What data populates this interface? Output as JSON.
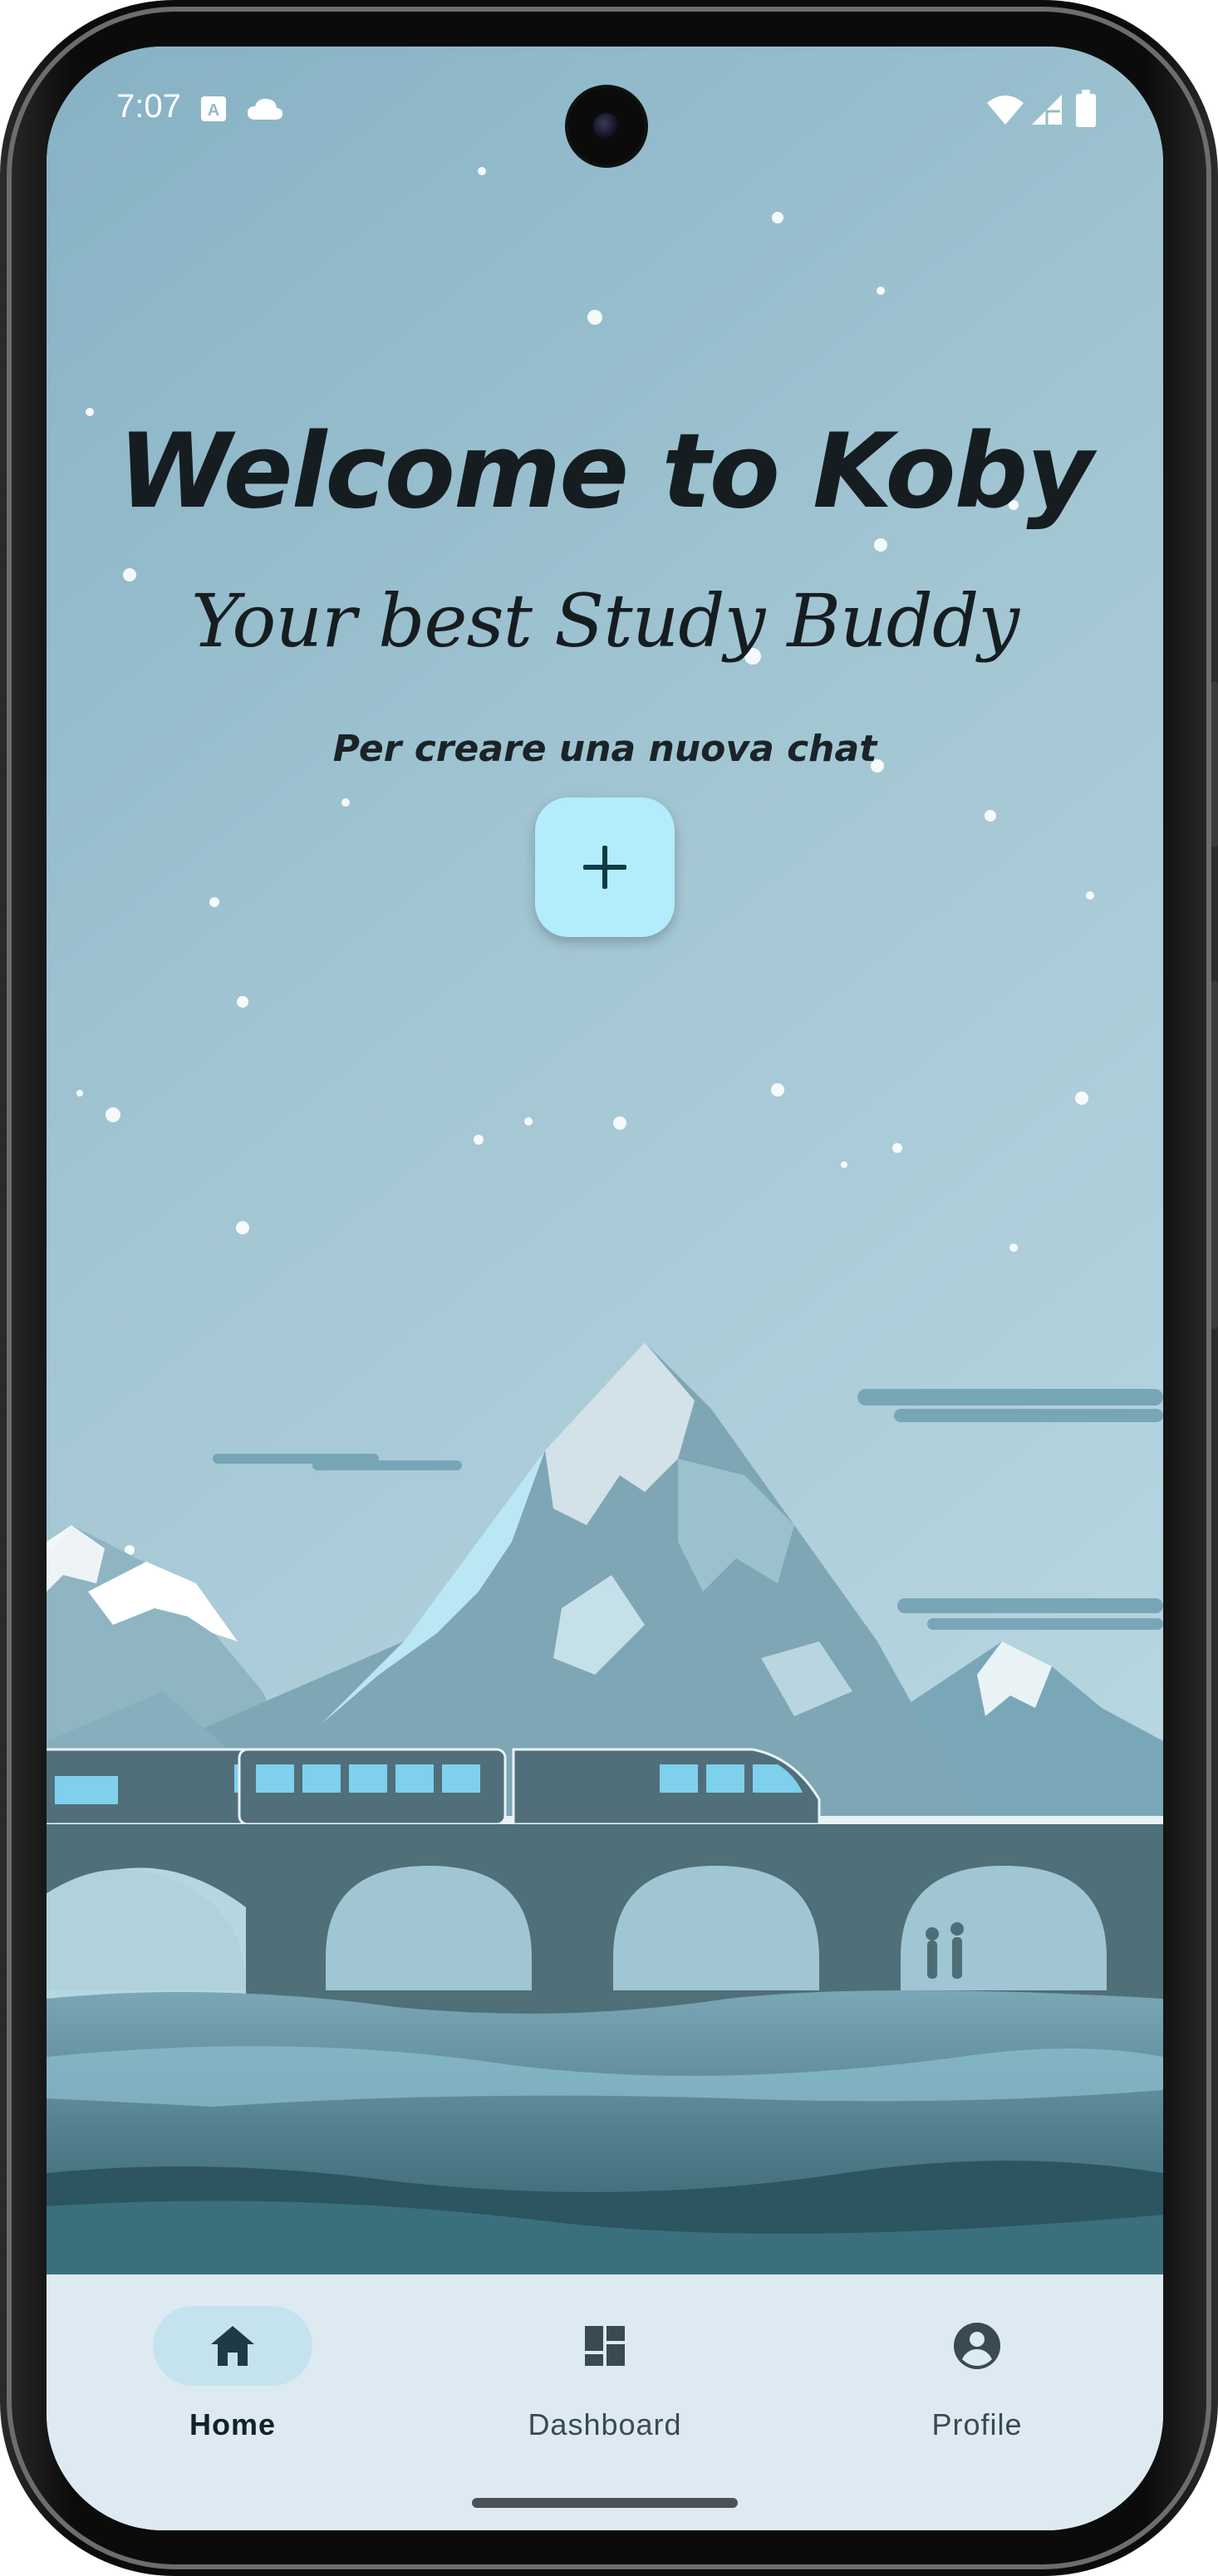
{
  "status_bar": {
    "time": "7:07"
  },
  "hero": {
    "title": "Welcome to Koby",
    "subtitle": "Your best Study Buddy",
    "hint": "Per creare una nuova chat"
  },
  "fab": {
    "icon": "plus-icon"
  },
  "bottom_nav": {
    "items": [
      {
        "label": "Home",
        "icon": "home-icon",
        "active": true
      },
      {
        "label": "Dashboard",
        "icon": "dashboard-icon",
        "active": false
      },
      {
        "label": "Profile",
        "icon": "account-circle-icon",
        "active": false
      }
    ]
  },
  "colors": {
    "sky": "#a7cad6",
    "fab": "#b3ecfd",
    "nav_background": "#deeaf1",
    "nav_active_pill": "#c5e3ee",
    "text": "#161d21"
  }
}
